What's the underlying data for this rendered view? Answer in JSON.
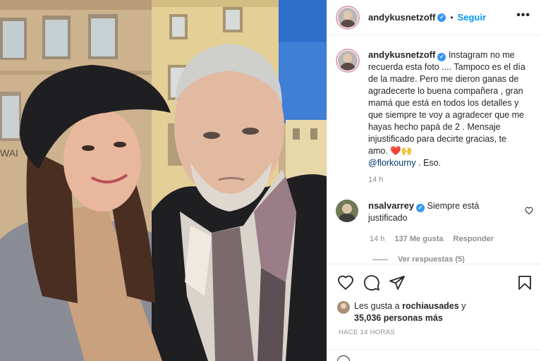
{
  "post": {
    "username": "andykusnetzoff",
    "follow_label": "Seguir",
    "more_label": "•••",
    "dot": "•"
  },
  "caption": {
    "username": "andykusnetzoff",
    "text_1": "Instagram no me recuerda esta foto .... Tampoco es el día de la madre. Pero me dieron ganas de agradecerte lo buena compañera , gran mamá que está en todos los detalles y que siempre te voy a agradecer que me hayas hecho papá de 2 . Mensaje injustificado para decirte gracias, te amo. ",
    "emojis": "❤️🙌",
    "mention": "@florkourny",
    "text_2": " . Eso.",
    "time": "14 h"
  },
  "comment": {
    "username": "nsalvarrey",
    "text": "Siempre está justificado",
    "time": "14 h",
    "likes": "137 Me gusta",
    "reply_label": "Responder",
    "view_replies": "Ver respuestas (5)"
  },
  "likes": {
    "prefix": "Les gusta a ",
    "user": "rochiausades",
    "connector": " y",
    "count": "35,036 personas más"
  },
  "time_ago": "HACE 14 HORAS",
  "icons": [
    "heart-icon",
    "comment-icon",
    "share-icon",
    "bookmark-icon",
    "verified-icon",
    "more-icon",
    "emoji-icon"
  ],
  "colors": {
    "link": "#0095f6",
    "verified": "#3897f0",
    "mention": "#00376b",
    "secondary": "#8e8e8e"
  }
}
